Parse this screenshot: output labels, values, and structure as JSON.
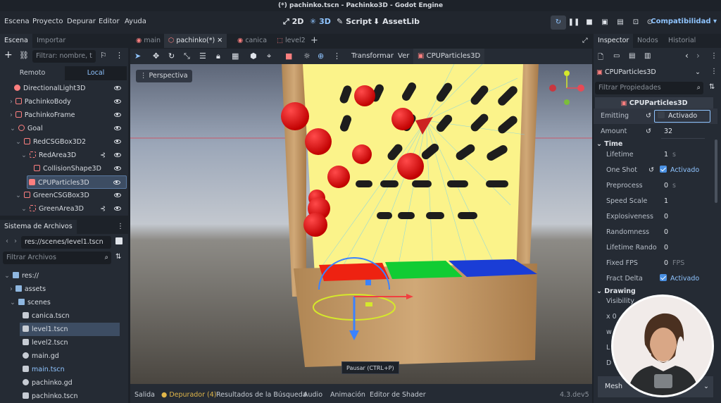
{
  "window": {
    "title": "(*) pachinko.tscn - Pachinko3D - Godot Engine"
  },
  "menu": [
    "Escena",
    "Proyecto",
    "Depurar",
    "Editor",
    "Ayuda"
  ],
  "modes": {
    "m2d": "2D",
    "m3d": "3D",
    "script": "Script",
    "assetlib": "AssetLib"
  },
  "renderer": "Compatibilidad",
  "scene_dock": {
    "tabs": [
      "Escena",
      "Importar"
    ],
    "filter_placeholder": "Filtrar: nombre, t",
    "remote_label": "Remoto",
    "local_label": "Local",
    "nodes": [
      {
        "label": "DirectionalLight3D",
        "icon": "light-icon"
      },
      {
        "label": "PachinkoBody",
        "icon": "body-icon"
      },
      {
        "label": "PachinkoFrame",
        "icon": "body-icon"
      },
      {
        "label": "Goal",
        "icon": "node3d-icon"
      },
      {
        "label": "RedCSGBox3D2",
        "icon": "csg-icon"
      },
      {
        "label": "RedArea3D",
        "icon": "area-icon"
      },
      {
        "label": "CollisionShape3D",
        "icon": "collision-icon"
      },
      {
        "label": "CPUParticles3D",
        "icon": "particles-icon"
      },
      {
        "label": "GreenCSGBox3D",
        "icon": "csg-icon"
      },
      {
        "label": "GreenArea3D",
        "icon": "area-icon"
      }
    ]
  },
  "filesystem": {
    "tab": "Sistema de Archivos",
    "path": "res://scenes/level1.tscn",
    "filter_placeholder": "Filtrar Archivos",
    "items": [
      {
        "label": "res://",
        "kind": "folder"
      },
      {
        "label": "assets",
        "kind": "folder"
      },
      {
        "label": "scenes",
        "kind": "folder"
      },
      {
        "label": "canica.tscn",
        "kind": "scene"
      },
      {
        "label": "level1.tscn",
        "kind": "scene"
      },
      {
        "label": "level2.tscn",
        "kind": "scene"
      },
      {
        "label": "main.gd",
        "kind": "script"
      },
      {
        "label": "main.tscn",
        "kind": "scene"
      },
      {
        "label": "pachinko.gd",
        "kind": "script"
      },
      {
        "label": "pachinko.tscn",
        "kind": "scene"
      }
    ]
  },
  "scene_tabs": [
    "main",
    "pachinko(*)",
    "canica",
    "level2"
  ],
  "toolbar": {
    "transform": "Transformar",
    "view": "Ver",
    "particles": "CPUParticles3D"
  },
  "viewport": {
    "perspective_label": "Perspectiva",
    "tooltip": "Pausar (CTRL+P)"
  },
  "bottom": {
    "items": [
      "Salida",
      "Depurador (4)",
      "Resultados de la Búsqueda",
      "Audio",
      "Animación",
      "Editor de Shader"
    ],
    "version": "4.3.dev5"
  },
  "inspector": {
    "tabs": [
      "Inspector",
      "Nodos",
      "Historial"
    ],
    "node": "CPUParticles3D",
    "filter_placeholder": "Filtrar Propiedades",
    "class_title": "CPUParticles3D",
    "emitting": {
      "label": "Emitting",
      "value": "Activado"
    },
    "amount": {
      "label": "Amount",
      "value": "32"
    },
    "time_section": "Time",
    "props": [
      {
        "label": "Lifetime",
        "value": "1",
        "unit": "s"
      },
      {
        "label": "One Shot",
        "value": "Activado",
        "check": true
      },
      {
        "label": "Preprocess",
        "value": "0",
        "unit": "s"
      },
      {
        "label": "Speed Scale",
        "value": "1"
      },
      {
        "label": "Explosiveness",
        "value": "0"
      },
      {
        "label": "Randomness",
        "value": "0"
      },
      {
        "label": "Lifetime Rando",
        "value": "0"
      },
      {
        "label": "Fixed FPS",
        "value": "0",
        "unit": "FPS"
      },
      {
        "label": "Fract Delta",
        "value": "Activado",
        "check": true
      }
    ],
    "drawing_section": "Drawing",
    "visibility": "Visibility",
    "mesh_label": "Mesh",
    "partial_rows": [
      "x 0",
      "w",
      "L",
      "D"
    ]
  }
}
